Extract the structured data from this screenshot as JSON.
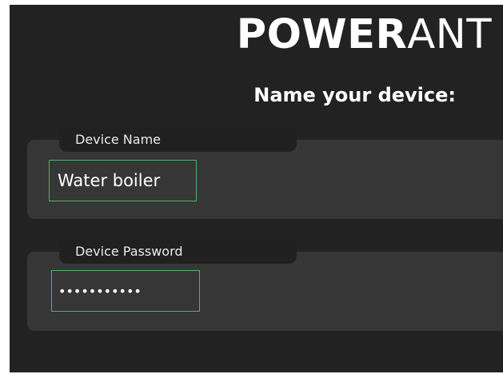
{
  "header": {
    "brand_bold": "POWER",
    "brand_light": "ANT",
    "subtitle": "Name your device:"
  },
  "form": {
    "device_name": {
      "label": "Device Name",
      "value": "Water boiler"
    },
    "device_password": {
      "label": "Device Password",
      "value": "•••••••••••"
    }
  },
  "colors": {
    "background": "#222222",
    "card": "#363636",
    "tab": "#202020",
    "field_border": "#55b06a",
    "text": "#ffffff"
  }
}
